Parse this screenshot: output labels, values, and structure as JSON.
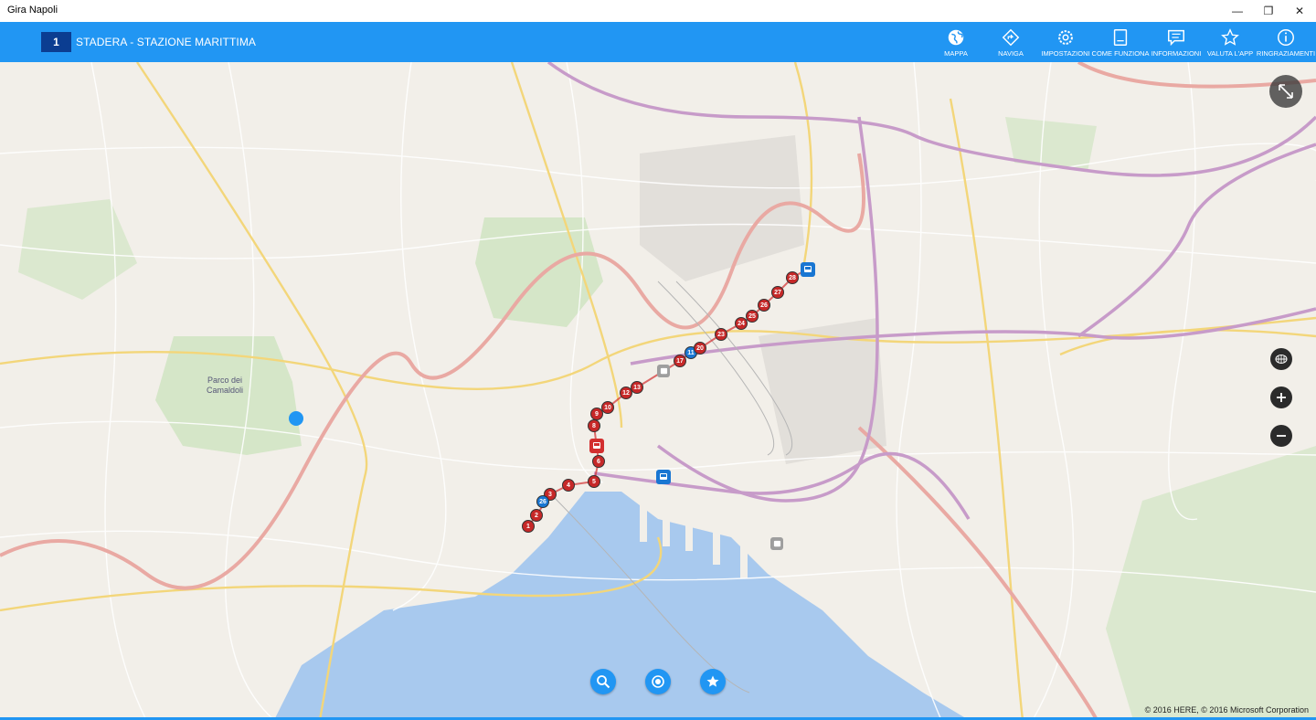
{
  "window": {
    "title": "Gira Napoli",
    "minimize_glyph": "—",
    "maximize_glyph": "❐",
    "close_glyph": "✕"
  },
  "appbar": {
    "line_number": "1",
    "route_name": "STADERA - STAZIONE MARITTIMA",
    "nav": [
      {
        "label": "MAPPA",
        "icon": "globe-icon"
      },
      {
        "label": "NAVIGA",
        "icon": "navigate-icon"
      },
      {
        "label": "IMPOSTAZIONI",
        "icon": "gear-icon"
      },
      {
        "label": "COME FUNZIONA",
        "icon": "book-icon"
      },
      {
        "label": "INFORMAZIONI",
        "icon": "message-icon"
      },
      {
        "label": "VALUTA L'APP",
        "icon": "star-icon"
      },
      {
        "label": "RINGRAZIAMENTI",
        "icon": "info-icon"
      }
    ]
  },
  "map": {
    "park_label": "Parco dei Camaldoli",
    "copyright": "© 2016 HERE, © 2016 Microsoft Corporation",
    "stops": [
      "1",
      "2",
      "3",
      "26",
      "4",
      "5",
      "6",
      "8",
      "9",
      "10",
      "12",
      "13",
      "17",
      "11",
      "20",
      "23",
      "24",
      "25",
      "26",
      "27",
      "28"
    ],
    "colors": {
      "stop": "#c62828",
      "bus": "#1976d2",
      "accent": "#2196f3",
      "water": "#a8c9ee"
    }
  },
  "fabs": [
    {
      "name": "search",
      "icon": "search-icon"
    },
    {
      "name": "locate",
      "icon": "target-icon"
    },
    {
      "name": "favorites",
      "icon": "star-icon"
    }
  ]
}
